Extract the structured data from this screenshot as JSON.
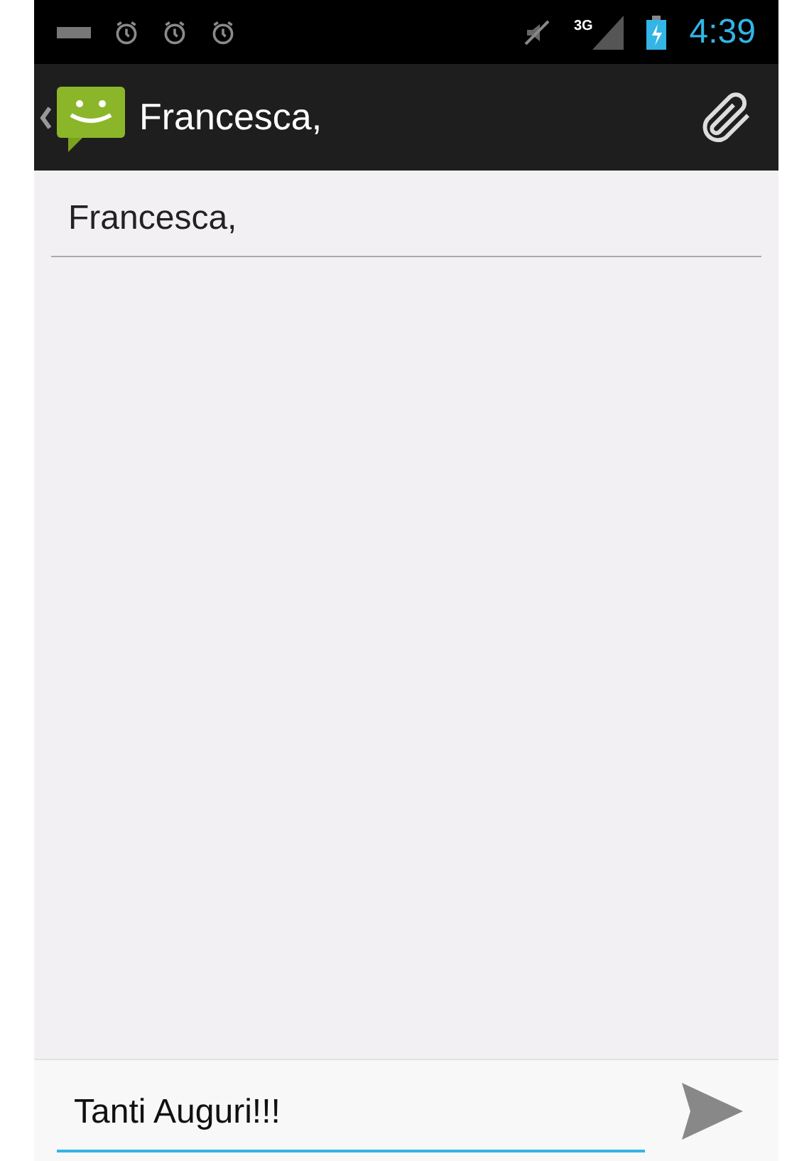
{
  "status_bar": {
    "time": "4:39",
    "network": "3G"
  },
  "action_bar": {
    "title": "Francesca,"
  },
  "recipient_field": {
    "value": "Francesca,"
  },
  "compose": {
    "value": "Tanti Auguri!!!"
  }
}
